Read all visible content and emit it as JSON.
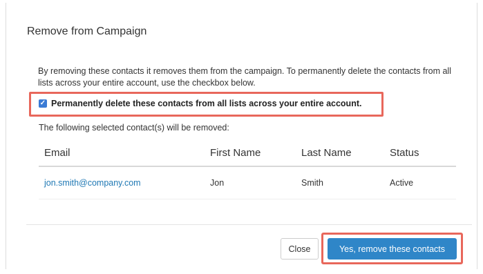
{
  "dialog": {
    "title": "Remove from Campaign",
    "description": "By removing these contacts it removes them from the campaign. To permanently delete the contacts from all lists across your entire account, use the checkbox below.",
    "checkbox": {
      "label": "Permanently delete these contacts from all lists across your entire account.",
      "checked": true,
      "icon": "checkmark-icon"
    },
    "selected_label": "The following selected contact(s) will be removed:",
    "table": {
      "columns": [
        "Email",
        "First Name",
        "Last Name",
        "Status"
      ],
      "rows": [
        [
          "jon.smith@company.com",
          "Jon",
          "Smith",
          "Active"
        ]
      ]
    },
    "buttons": {
      "close": "Close",
      "confirm": "Yes, remove these contacts"
    }
  },
  "colors": {
    "primary_button": "#2f86c8",
    "highlight": "#e8675b",
    "link": "#1f78b4",
    "checkbox": "#3a7bd5"
  }
}
